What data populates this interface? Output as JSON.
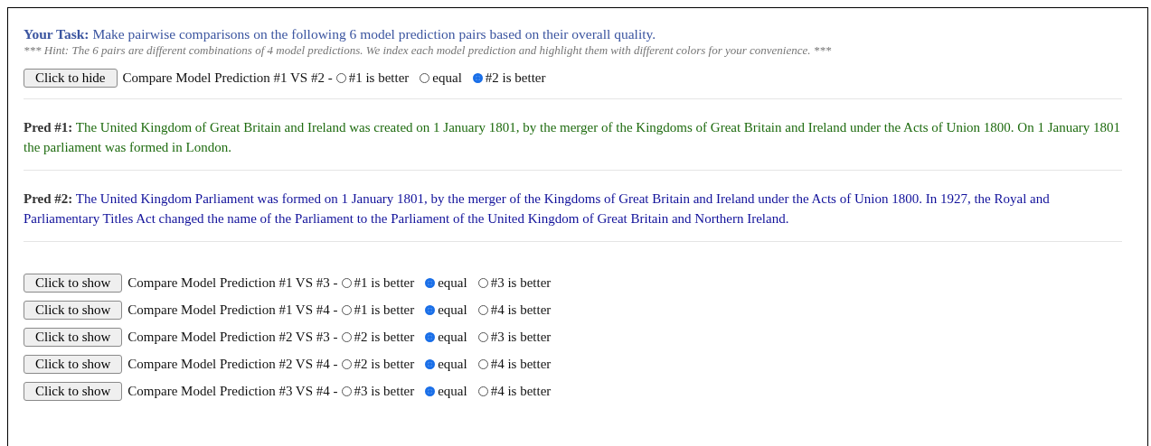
{
  "task": {
    "text": "**Your Task:** Make pairwise comparisons on the following 6 model prediction pairs based on their overall quality.",
    "hint": "*** Hint: The 6 pairs are different combinations of 4 model predictions. We index each model prediction and highlight them with different colors for your convenience. ***"
  },
  "comparisons": [
    {
      "button": "Click to hide",
      "expanded": true,
      "prompt": "Compare Model Prediction #1 VS #2 -",
      "options": [
        {
          "label": "#1 is better",
          "selected": false
        },
        {
          "label": "equal",
          "selected": false
        },
        {
          "label": "#2 is better",
          "selected": true
        }
      ],
      "predictions": [
        {
          "label": "Pred #1:",
          "text": "The United Kingdom of Great Britain and Ireland was created on 1 January 1801, by the merger of the Kingdoms of Great Britain and Ireland under the Acts of Union 1800. On 1 January 1801 the parliament was formed in London.",
          "color": "#1e6b0f"
        },
        {
          "label": "Pred #2:",
          "text": "The United Kingdom Parliament was formed on 1 January 1801, by the merger of the Kingdoms of Great Britain and Ireland under the Acts of Union 1800. In 1927, the Royal and Parliamentary Titles Act changed the name of the Parliament to the Parliament of the United Kingdom of Great Britain and Northern Ireland.",
          "color": "#10109a"
        }
      ]
    },
    {
      "button": "Click to show",
      "expanded": false,
      "prompt": "Compare Model Prediction #1 VS #3 -",
      "options": [
        {
          "label": "#1 is better",
          "selected": false
        },
        {
          "label": "equal",
          "selected": true
        },
        {
          "label": "#3 is better",
          "selected": false
        }
      ]
    },
    {
      "button": "Click to show",
      "expanded": false,
      "prompt": "Compare Model Prediction #1 VS #4 -",
      "options": [
        {
          "label": "#1 is better",
          "selected": false
        },
        {
          "label": "equal",
          "selected": true
        },
        {
          "label": "#4 is better",
          "selected": false
        }
      ]
    },
    {
      "button": "Click to show",
      "expanded": false,
      "prompt": "Compare Model Prediction #2 VS #3 -",
      "options": [
        {
          "label": "#2 is better",
          "selected": false
        },
        {
          "label": "equal",
          "selected": true
        },
        {
          "label": "#3 is better",
          "selected": false
        }
      ]
    },
    {
      "button": "Click to show",
      "expanded": false,
      "prompt": "Compare Model Prediction #2 VS #4 -",
      "options": [
        {
          "label": "#2 is better",
          "selected": false
        },
        {
          "label": "equal",
          "selected": true
        },
        {
          "label": "#4 is better",
          "selected": false
        }
      ]
    },
    {
      "button": "Click to show",
      "expanded": false,
      "prompt": "Compare Model Prediction #3 VS #4 -",
      "options": [
        {
          "label": "#3 is better",
          "selected": false
        },
        {
          "label": "equal",
          "selected": true
        },
        {
          "label": "#4 is better",
          "selected": false
        }
      ]
    }
  ]
}
